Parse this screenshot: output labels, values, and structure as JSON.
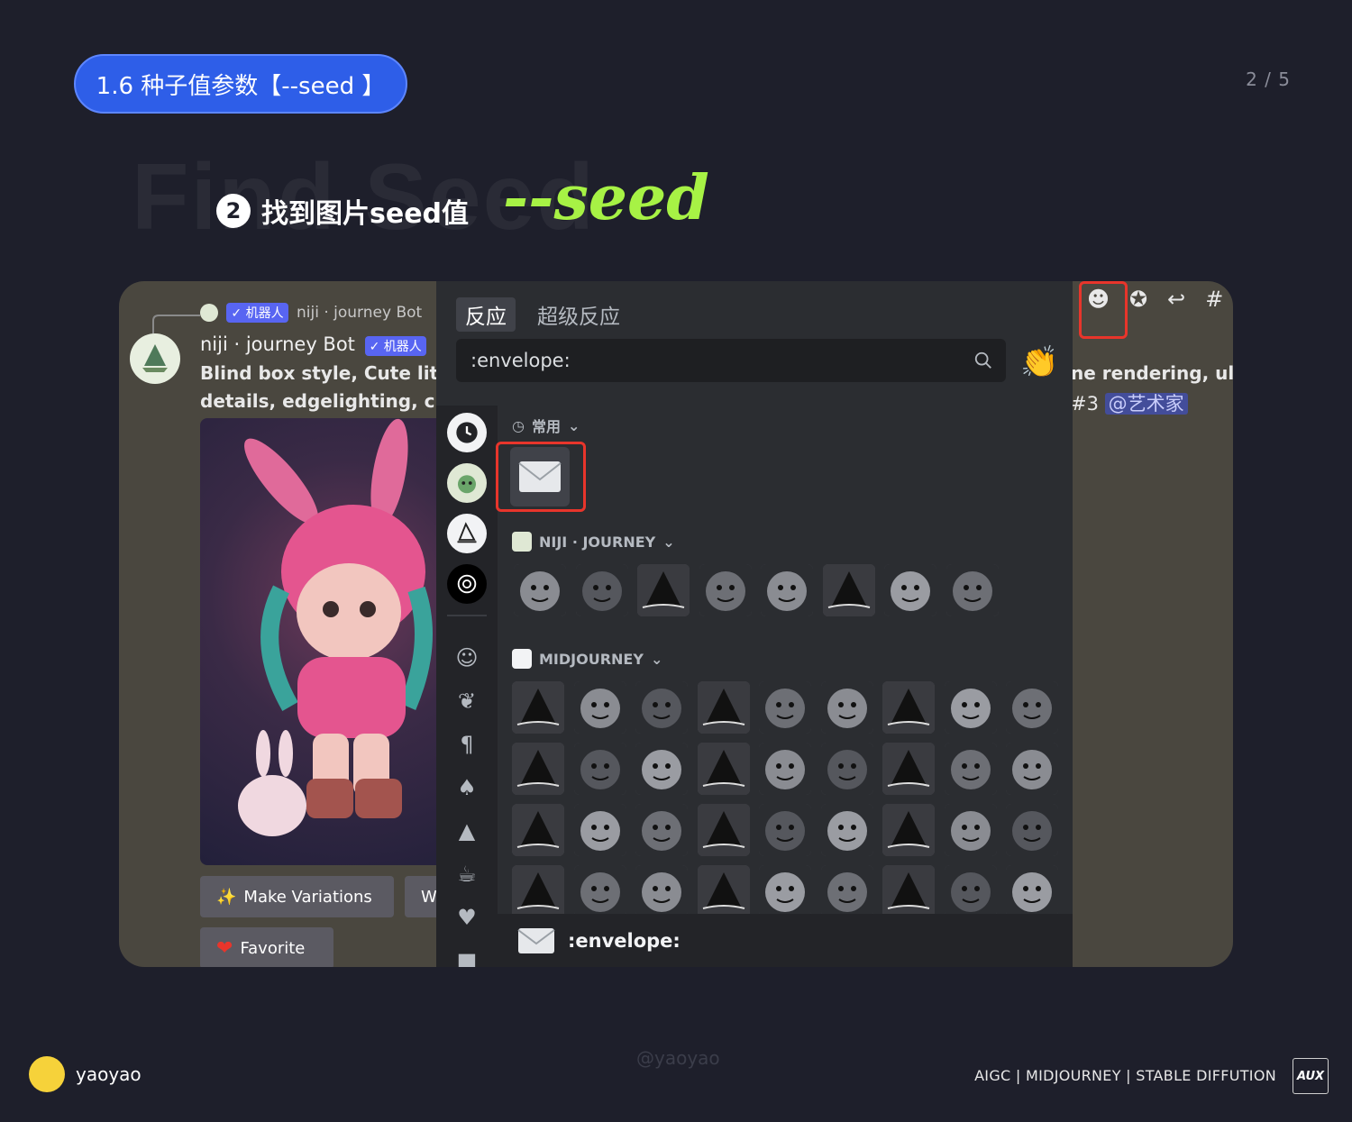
{
  "header": {
    "pill": "1.6 种子值参数【--seed 】",
    "pager": "2 / 5"
  },
  "heading": {
    "ghost": "Find Seed",
    "step_num": "2",
    "step_text": "找到图片seed值",
    "seed_word": "--seed"
  },
  "chat": {
    "reply_badge": "✓ 机器人",
    "reply_text": "niji · journey Bot",
    "author": "niji · journey Bot",
    "author_badge": "✓ 机器人",
    "line1": "Blind box style, Cute little",
    "line2": "details, edgelighting, chibi",
    "make_variations": "Make Variations",
    "second_button": "W",
    "favorite": "Favorite",
    "right_line1": "ne rendering, ultra",
    "right_line2_prefix": "#3",
    "mention": "@艺术家"
  },
  "picker": {
    "tab_reactions": "反应",
    "tab_super": "超级反应",
    "search_value": ":envelope:",
    "section_frequent": "常用",
    "section_niji": "NIJI · JOURNEY",
    "section_mid": "MIDJOURNEY",
    "footer_name": ":envelope:"
  },
  "icons": {
    "add_reaction": "add-reaction-icon",
    "super_reaction": "super-reaction-icon",
    "reply": "reply-icon",
    "thread": "thread-icon"
  },
  "footer": {
    "watermark": "@yaoyao",
    "brand": "yaoyao",
    "tags": "AIGC | MIDJOURNEY | STABLE DIFFUTION",
    "aux": "AUX"
  },
  "colors": {
    "accent_blue": "#2e5ee8",
    "seed_green": "#a7f245",
    "highlight_red": "#e8352b",
    "discord_blurple": "#5865f2"
  }
}
